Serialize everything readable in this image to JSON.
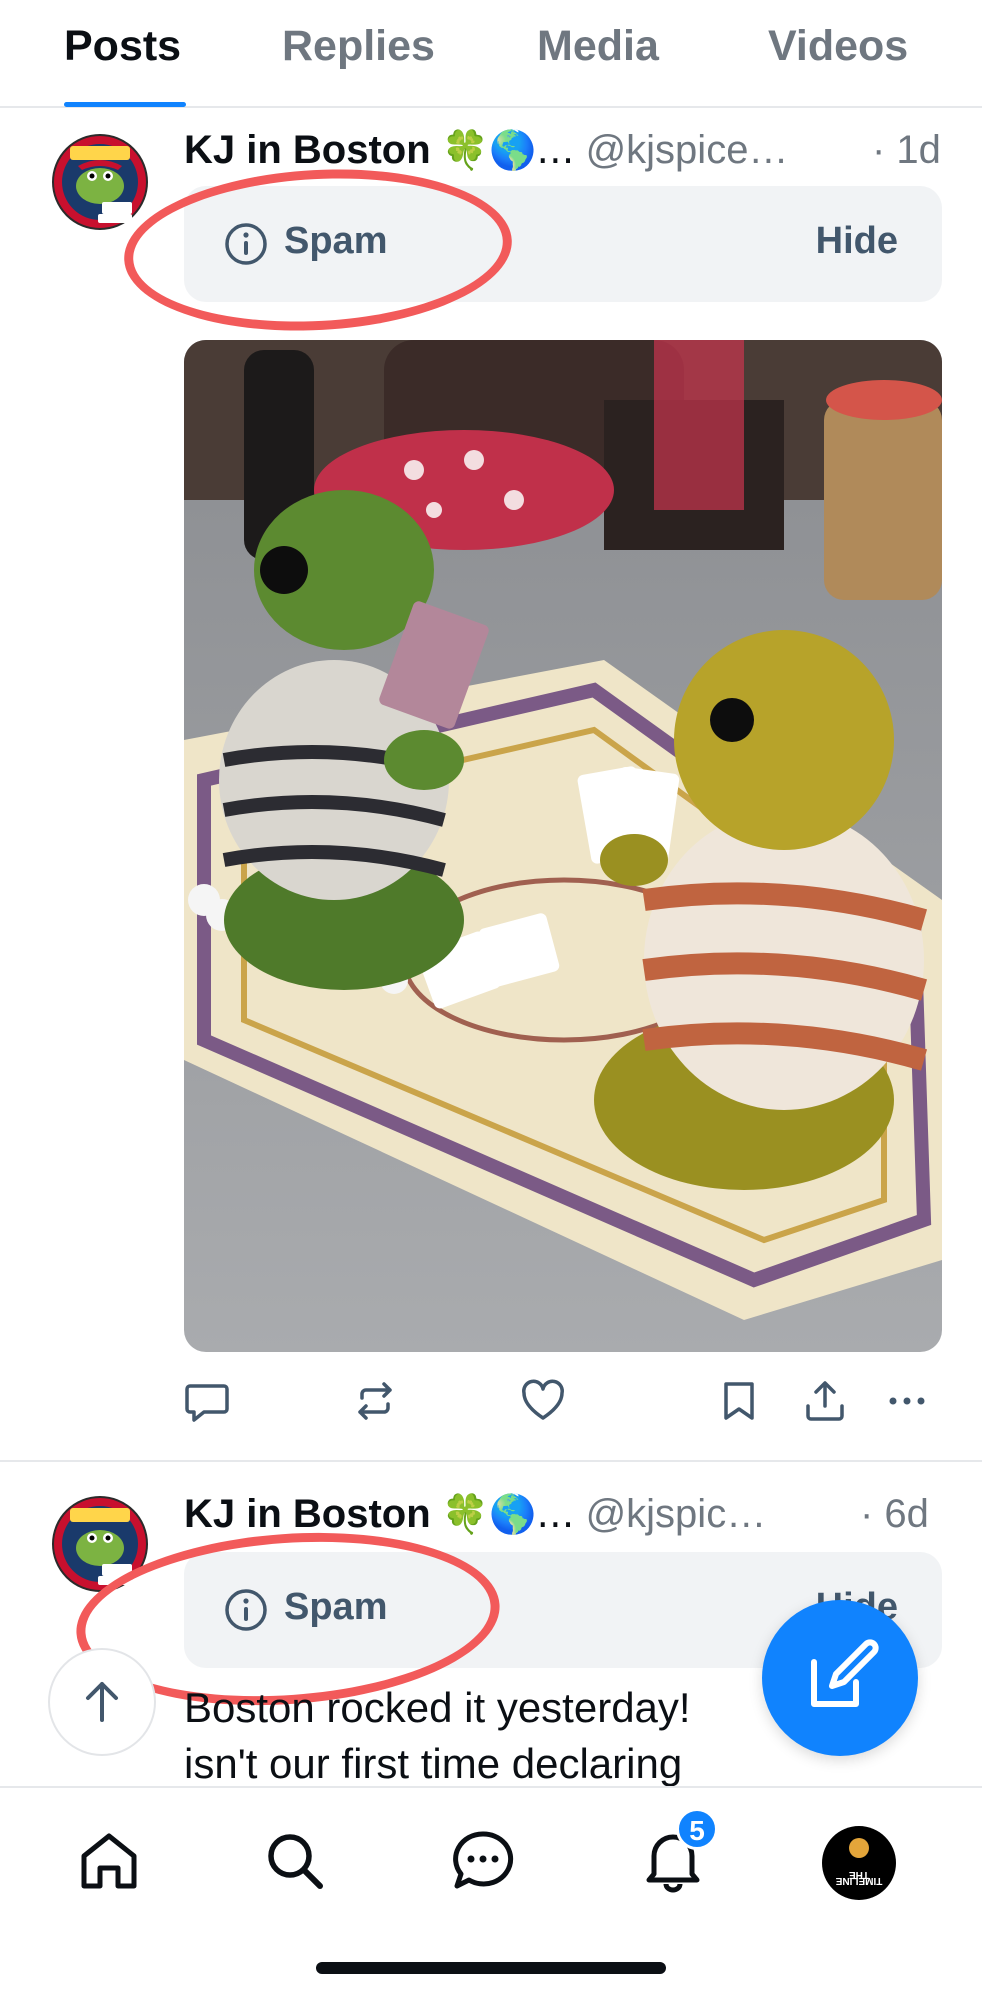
{
  "tabs": [
    {
      "label": "Posts",
      "active": true
    },
    {
      "label": "Replies",
      "active": false
    },
    {
      "label": "Media",
      "active": false
    },
    {
      "label": "Videos",
      "active": false
    }
  ],
  "posts": [
    {
      "author": "KJ in Boston",
      "author_emojis": "🍀🌎…",
      "handle": "@kjspice…",
      "time": "· 1d",
      "label": "Spam",
      "label_action": "Hide",
      "media_description": "knitted-frogs-playing-cards",
      "avatar_text": "We Can Do It! ROSIE RIBBITER"
    },
    {
      "author": "KJ in Boston",
      "author_emojis": "🍀🌎…",
      "handle": "@kjspic…",
      "time": "· 6d",
      "label": "Spam",
      "label_action": "Hide",
      "text_line1": "Boston rocked it yesterday!",
      "text_line2": "isn't our first time declaring",
      "avatar_text": "We Can Do It! ROSIE RIBBITER"
    }
  ],
  "actions": [
    "reply-icon",
    "repost-icon",
    "like-icon",
    "bookmark-icon",
    "share-icon",
    "more-icon"
  ],
  "bottom_nav": {
    "items": [
      "home-icon",
      "search-icon",
      "chat-icon",
      "notifications-icon",
      "profile-avatar"
    ],
    "notification_count": "5",
    "profile_avatar_text": "THE TIMELINE"
  },
  "colors": {
    "accent": "#1083fe",
    "annotation": "#f25a5a",
    "label_bg": "#f1f3f5",
    "label_text": "#42576c"
  }
}
